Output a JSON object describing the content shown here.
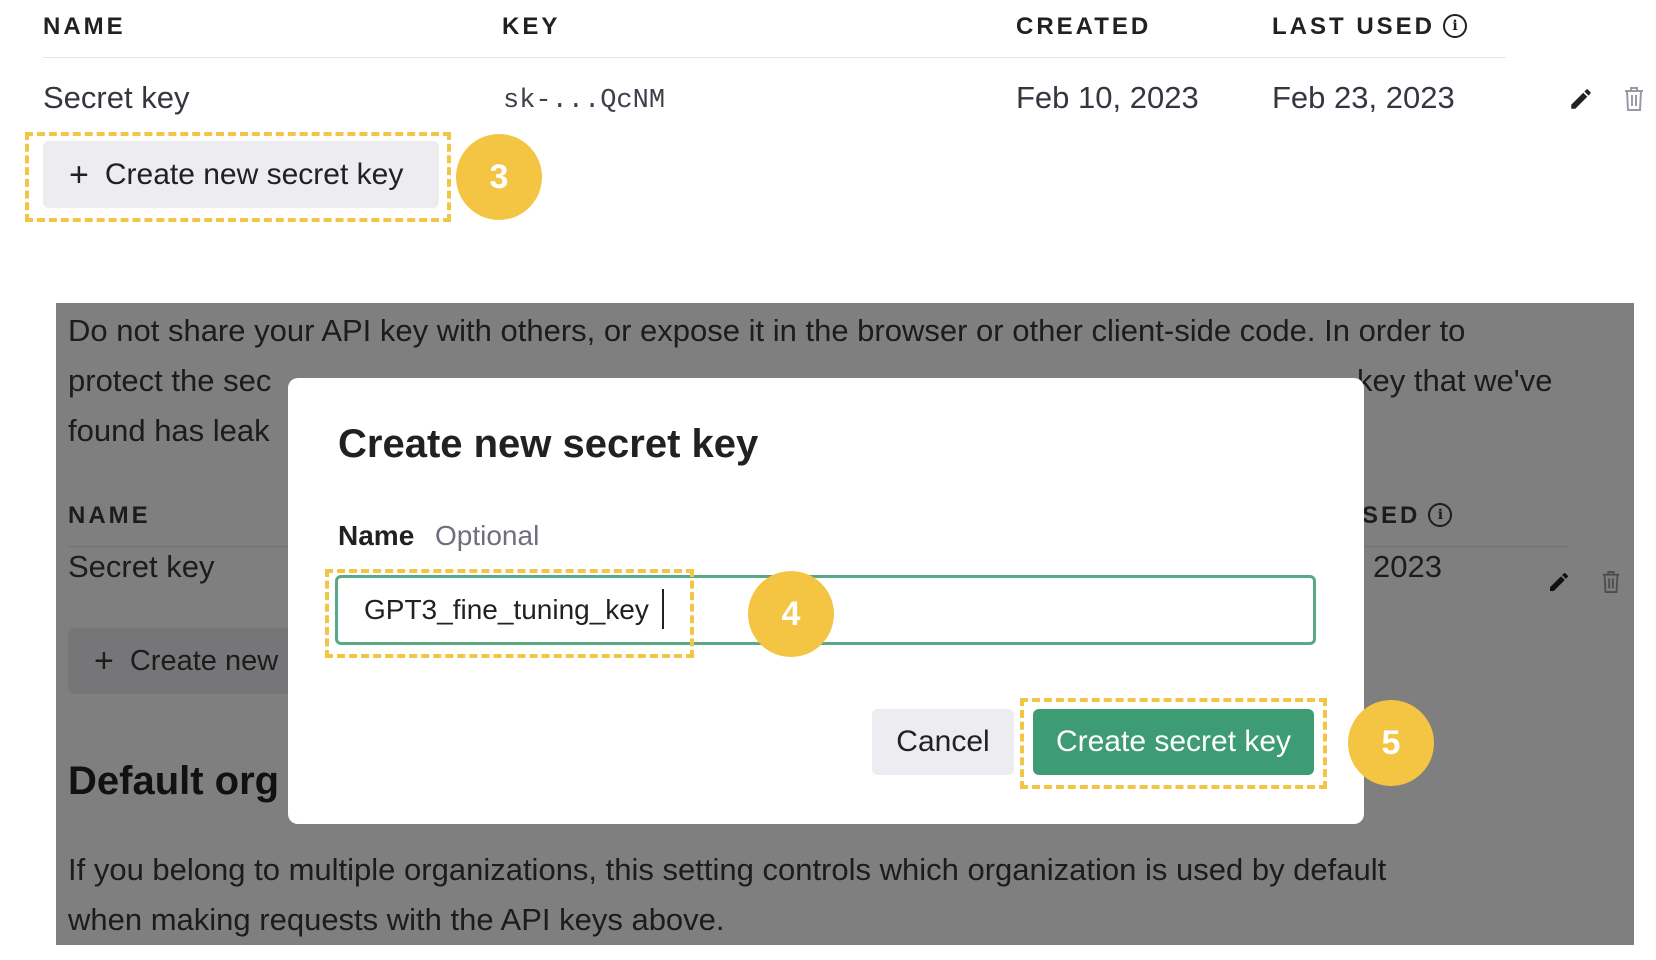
{
  "table": {
    "headers": {
      "name": "NAME",
      "key": "KEY",
      "created": "CREATED",
      "last_used": "LAST USED"
    },
    "rows": [
      {
        "name": "Secret key",
        "key": "sk-...QcNM",
        "created": "Feb 10, 2023",
        "last_used": "Feb 23, 2023"
      }
    ],
    "create_button_label": "Create new secret key"
  },
  "callouts": {
    "step3": "3",
    "step4": "4",
    "step5": "5"
  },
  "background_page": {
    "warning_line1": "Do not share your API key with others, or expose it in the browser or other client-side code. In order to",
    "warning_line2_start": "protect the sec",
    "warning_line2_end": "key that we've",
    "warning_line3_start": "found has leak",
    "table_header_name": "NAME",
    "table_header_last_used_partial": "SED",
    "row_name": "Secret key",
    "row_last_used_partial": "2023",
    "create_button_partial": "Create new",
    "default_org_heading_partial": "Default org",
    "default_org_line1": "If you belong to multiple organizations, this setting controls which organization is used by default",
    "default_org_line2": "when making requests with the API keys above."
  },
  "modal": {
    "title": "Create new secret key",
    "name_label": "Name",
    "name_optional": "Optional",
    "name_value": "GPT3_fine_tuning_key",
    "cancel_label": "Cancel",
    "submit_label": "Create secret key"
  },
  "colors": {
    "accent_green": "#3d9c74",
    "input_border": "#5ba887",
    "callout_yellow": "#f4c542",
    "overlay_gray": "#7f7f7f"
  },
  "icons": [
    "plus-icon",
    "info-icon",
    "pencil-icon",
    "trash-icon"
  ]
}
